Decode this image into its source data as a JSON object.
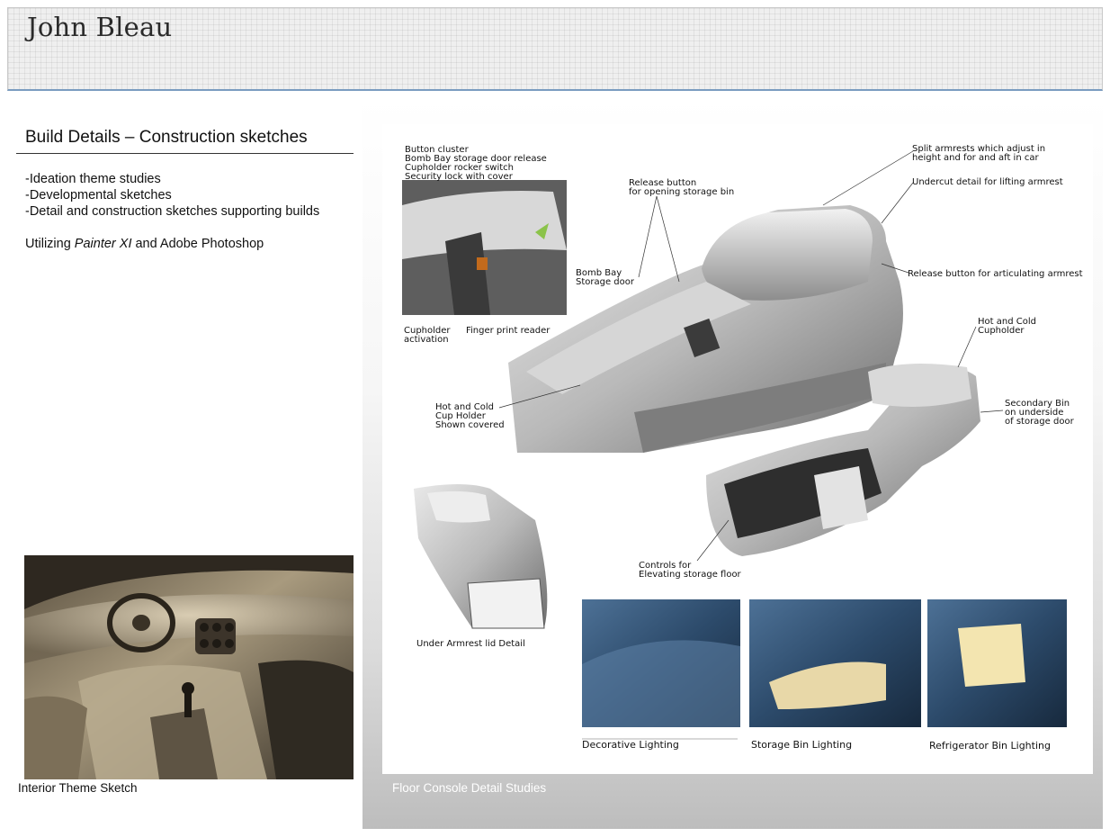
{
  "header": {
    "title": "John Bleau"
  },
  "left": {
    "section_title": "Build Details – Construction sketches",
    "bullets": [
      "-Ideation theme studies",
      "-Developmental sketches",
      "-Detail and construction sketches supporting builds"
    ],
    "tools": {
      "prefix": "Utilizing ",
      "emphasis": "Painter XI",
      "suffix": "  and Adobe Photoshop"
    },
    "image_caption": "Interior Theme Sketch"
  },
  "right": {
    "caption": "Floor Console Detail Studies",
    "annotations": {
      "button_cluster": [
        "Button cluster",
        "Bomb Bay storage door release",
        "Cupholder rocker switch",
        "Security lock with cover"
      ],
      "release_storage": [
        "Release button",
        "for opening storage bin"
      ],
      "split_armrests": [
        "Split armrests which adjust in",
        "height and for and aft in car"
      ],
      "undercut": [
        "Undercut detail for lifting armrest"
      ],
      "release_articulating": [
        "Release button for articulating armrest"
      ],
      "bomb_bay": [
        "Bomb Bay",
        "Storage door"
      ],
      "cupholder_activation": [
        "Cupholder",
        "activation"
      ],
      "finger_print": [
        "Finger print reader"
      ],
      "hot_cold_cupholder": [
        "Hot and Cold",
        "Cupholder"
      ],
      "hot_cold_covered": [
        "Hot and Cold",
        "Cup Holder",
        "Shown covered"
      ],
      "secondary_bin": [
        "Secondary Bin",
        "on underside",
        "of storage door"
      ],
      "controls": [
        "Controls for",
        "Elevating storage floor"
      ],
      "under_armrest": [
        "Under Armrest lid Detail"
      ]
    },
    "thumbnails": [
      "Decorative Lighting",
      "Storage Bin Lighting",
      "Refrigerator Bin Lighting"
    ]
  }
}
